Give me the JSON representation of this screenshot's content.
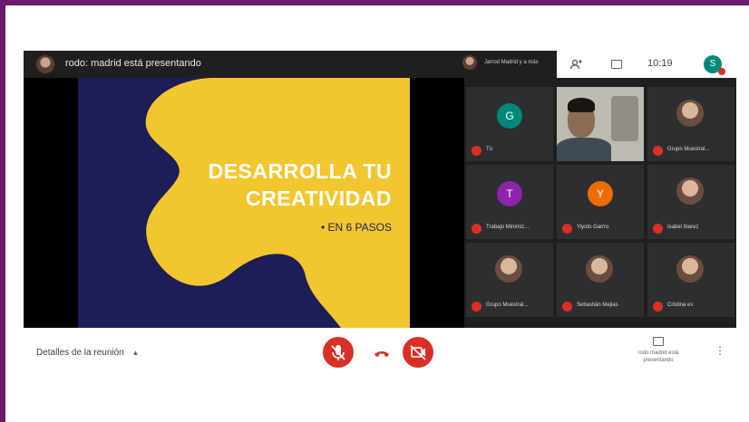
{
  "presenter": {
    "text": "rodo: madrid está presentando",
    "mini_label": "Jarrod Madrid y a más"
  },
  "toolbar": {
    "time": "10:19",
    "user_initial": "S",
    "icons": [
      "people-icon",
      "chat-icon"
    ]
  },
  "slide": {
    "title_line1": "DESARROLLA TU",
    "title_line2": "CREATIVIDAD",
    "bullet": "• EN 6 PASOS",
    "colors": {
      "background": "#1d1d57",
      "blob": "#f2c62e"
    }
  },
  "participants": [
    {
      "name": "Tú",
      "initial": "G",
      "color": "#00897b",
      "kind": "initial"
    },
    {
      "name": "",
      "kind": "video"
    },
    {
      "name": "Grupo Muestral...",
      "kind": "photo"
    },
    {
      "name": "Trabajo Minimiz...",
      "initial": "T",
      "color": "#8e24aa",
      "kind": "initial"
    },
    {
      "name": "Yiyoto Garrro",
      "initial": "Y",
      "color": "#ef6c00",
      "kind": "initial"
    },
    {
      "name": "Isabel Ibarez",
      "kind": "photo"
    },
    {
      "name": "Grupo Muestral...",
      "kind": "photo"
    },
    {
      "name": "Sebastián Mejias",
      "kind": "photo"
    },
    {
      "name": "Cristina es",
      "kind": "photo"
    }
  ],
  "bottom": {
    "details_label": "Detalles de la reunión",
    "present_label": "rodo madrid está presentando",
    "more_icon": "⋮"
  },
  "colors": {
    "accent_red": "#d93025",
    "frame": "#6a1b6e"
  }
}
